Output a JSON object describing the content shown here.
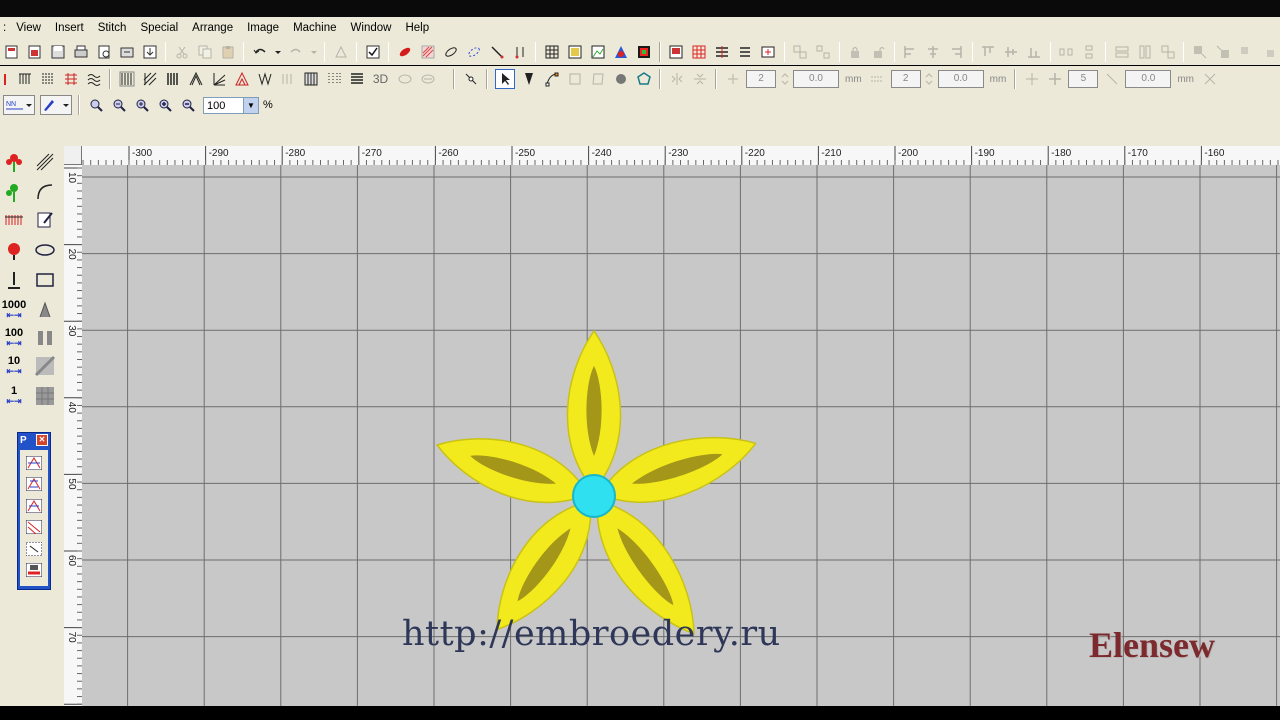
{
  "app": {
    "menus": [
      "View",
      "Insert",
      "Stitch",
      "Special",
      "Arrange",
      "Image",
      "Machine",
      "Window",
      "Help"
    ]
  },
  "toolbar": {
    "zoom_value": "100",
    "zoom_unit": "%",
    "lock_count_1": "2",
    "offset_1": "0.0",
    "unit_1": "mm",
    "lock_count_2": "2",
    "offset_2": "0.0",
    "unit_2": "mm",
    "step_count": "5",
    "offset_3": "0.0",
    "unit_3": "mm",
    "three_d_label": "3D"
  },
  "left_toolbar": {
    "stitch_count_1000": "1000",
    "stitch_count_100": "100",
    "stitch_count_10": "10",
    "stitch_count_1": "1"
  },
  "palette": {
    "title": "P"
  },
  "ruler": {
    "top_labels": [
      "-300",
      "-290",
      "-280",
      "-270",
      "-260",
      "-250",
      "-240",
      "-230",
      "-220",
      "-210",
      "-200",
      "-190",
      "-180",
      "-170",
      "-160"
    ],
    "left_labels": [
      "10",
      "20",
      "30",
      "40",
      "50",
      "60",
      "70",
      "80"
    ]
  },
  "design": {
    "petal_color": "#f2ea1c",
    "petal_shadow": "#8a7a18",
    "center_color": "#2ee0f0"
  },
  "watermark": {
    "url": "http://embroedery.ru",
    "brand": "Elensew"
  }
}
